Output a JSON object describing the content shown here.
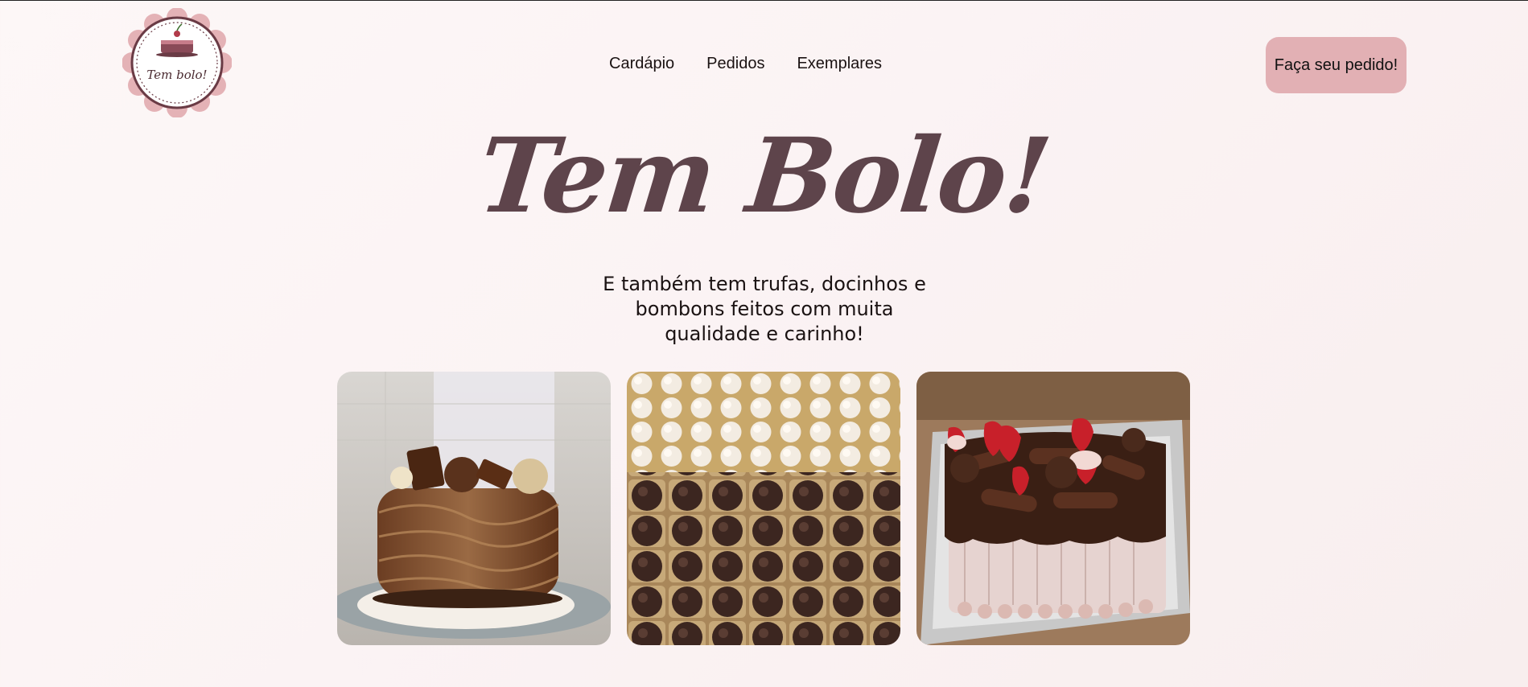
{
  "brand": {
    "logo_text": "Tem bolo!",
    "logo_icon": "cake-icon"
  },
  "nav": {
    "items": [
      "Cardápio",
      "Pedidos",
      "Exemplares"
    ]
  },
  "cta": {
    "label": "Faça seu pedido!"
  },
  "hero": {
    "title": "Tem Bolo!",
    "subtitle": "E também tem trufas, docinhos e bombons feitos com muita qualidade e carinho!"
  },
  "gallery": {
    "images": [
      "chocolate-wave-cake-photo",
      "brigadeiros-and-truffles-photo",
      "chocolate-strawberry-cake-photo"
    ]
  },
  "colors": {
    "accent": "#e2b0b4",
    "title": "#5e444b",
    "background": "#fbf3f4"
  }
}
